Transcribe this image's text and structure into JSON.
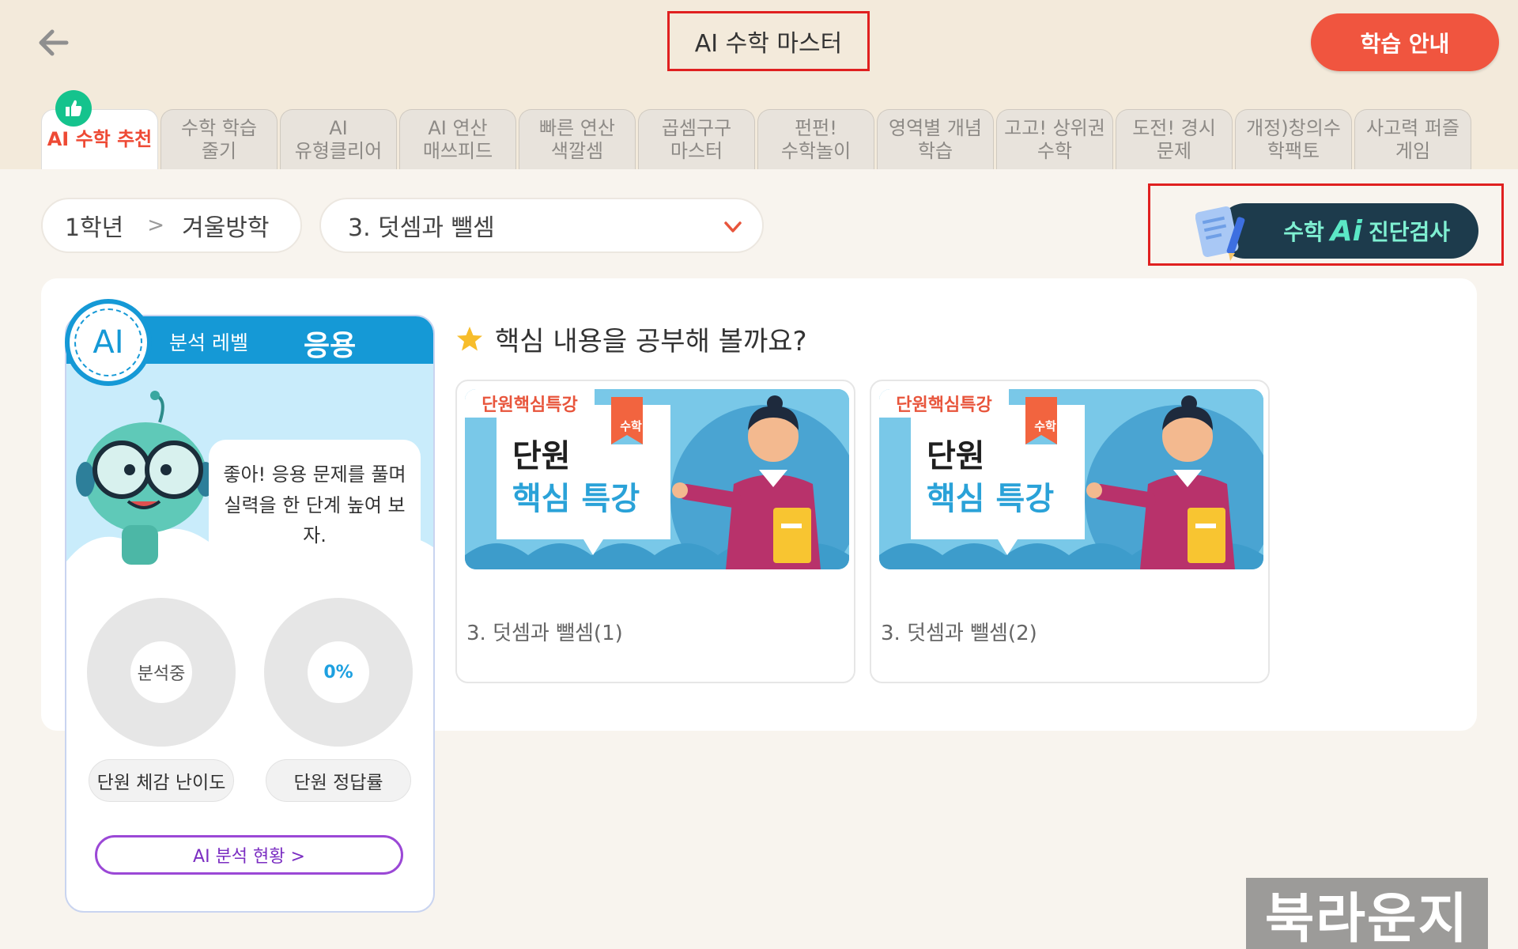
{
  "header": {
    "title": "AI 수학 마스터",
    "guide_label": "학습 안내"
  },
  "tabs": [
    {
      "label": "AI 수학 추천",
      "active": true
    },
    {
      "label": "수학 학습\n줄기",
      "active": false
    },
    {
      "label": "AI\n유형클리어",
      "active": false
    },
    {
      "label": "AI 연산\n매쓰피드",
      "active": false
    },
    {
      "label": "빠른 연산\n색깔셈",
      "active": false
    },
    {
      "label": "곱셈구구\n마스터",
      "active": false
    },
    {
      "label": "펀펀!\n수학놀이",
      "active": false
    },
    {
      "label": "영역별 개념\n학습",
      "active": false
    },
    {
      "label": "고고! 상위권\n수학",
      "active": false
    },
    {
      "label": "도전! 경시\n문제",
      "active": false
    },
    {
      "label": "개정)창의수\n학팩토",
      "active": false
    },
    {
      "label": "사고력 퍼즐\n게임",
      "active": false
    }
  ],
  "filters": {
    "grade": "1학년",
    "separator": ">",
    "term": "겨울방학",
    "unit": "3. 덧셈과 뺄셈"
  },
  "diagnosis": {
    "prefix": "수학",
    "ai_logo": "Ai",
    "suffix": "진단검사"
  },
  "ai_card": {
    "badge": "AI",
    "level_label": "분석 레벨",
    "level_value": "응용",
    "bubble_text": "좋아! 응용 문제를 풀며 실력을 한 단계 높여 보자.",
    "difficulty_center": "분석중",
    "difficulty_label": "단원 체감 난이도",
    "accuracy_center": "0%",
    "accuracy_label": "단원 정답률",
    "analysis_button": "AI 분석 현황 >"
  },
  "section": {
    "title": "핵심 내용을 공부해 볼까요?"
  },
  "lessons": [
    {
      "tag": "단원핵심특강",
      "sticker": "수학",
      "line1": "단원",
      "line2": "핵심 특강",
      "title": "3. 덧셈과 뺄셈(1)"
    },
    {
      "tag": "단원핵심특강",
      "sticker": "수학",
      "line1": "단원",
      "line2": "핵심 특강",
      "title": "3. 덧셈과 뺄셈(2)"
    }
  ],
  "watermark": "북라운지",
  "colors": {
    "accent_orange": "#f0553f",
    "highlight_red": "#e02020",
    "ai_blue": "#1599d6",
    "mint": "#15c38d",
    "purple": "#9b48d6"
  }
}
